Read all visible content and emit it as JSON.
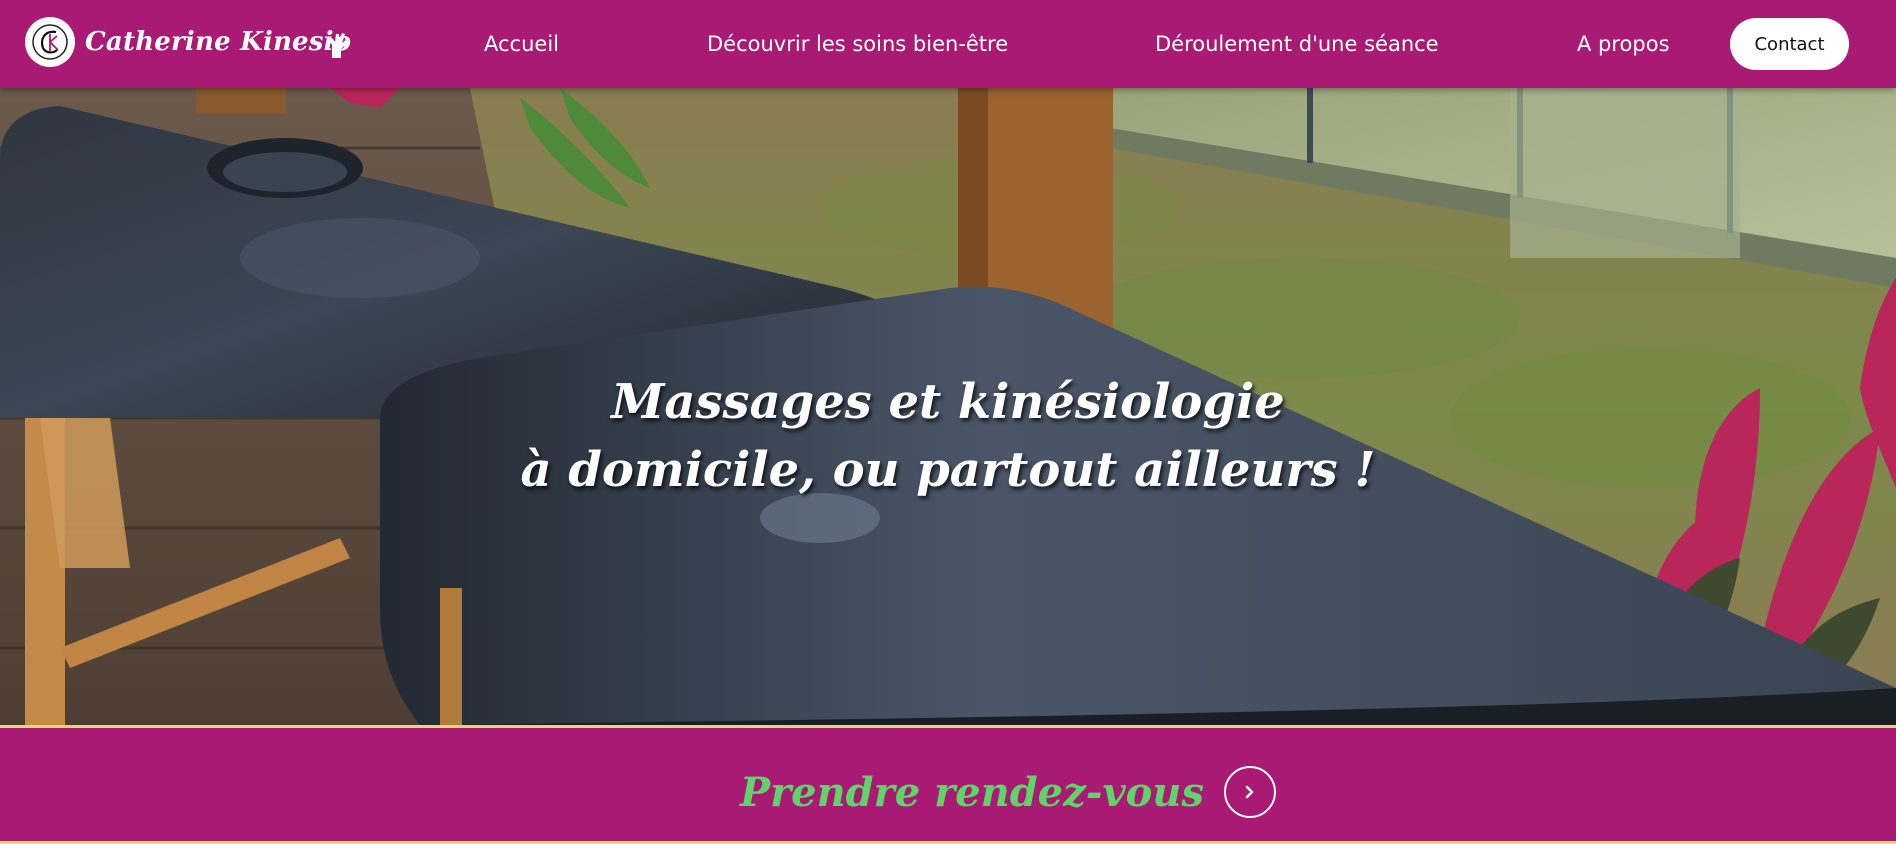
{
  "brand": {
    "name": "Catherine Kinesio",
    "logo_letters": "CK"
  },
  "nav": {
    "items": [
      {
        "label": "Accueil"
      },
      {
        "label": "Découvrir les soins bien-être"
      },
      {
        "label": "Déroulement d'une séance"
      },
      {
        "label": "A propos"
      }
    ],
    "contact_label": "Contact",
    "icon": "hand-icon"
  },
  "hero": {
    "title_line1": "Massages et kinésiologie",
    "title_line2": "à domicile, ou partout ailleurs !",
    "image_subject": "massage-table-on-terrace"
  },
  "cta": {
    "label": "Prendre rendez-vous",
    "icon": "chevron-right-icon"
  },
  "colors": {
    "primary": "#a91a75",
    "cta_text": "#5fd468",
    "accent_line": "#e2d96a",
    "white": "#ffffff"
  }
}
